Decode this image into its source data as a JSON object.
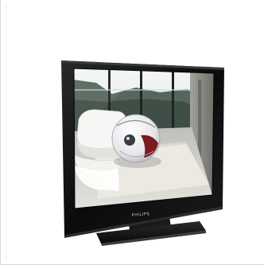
{
  "product": {
    "brand_label": "PHILIPS",
    "bezel_color": "#0d0d0d",
    "stand_color": "#141414",
    "screen_palette": {
      "sky": "#e9eef2",
      "glass": "#a9b2b5",
      "trees": "#3e4d45",
      "floor": "#cfd0cc",
      "rug": "#e8e6e0",
      "wall": "#8f8e88",
      "chair": "#f4f4f2",
      "robot_shell": "#f1f1f3",
      "robot_accent": "#7b1a1f"
    }
  }
}
